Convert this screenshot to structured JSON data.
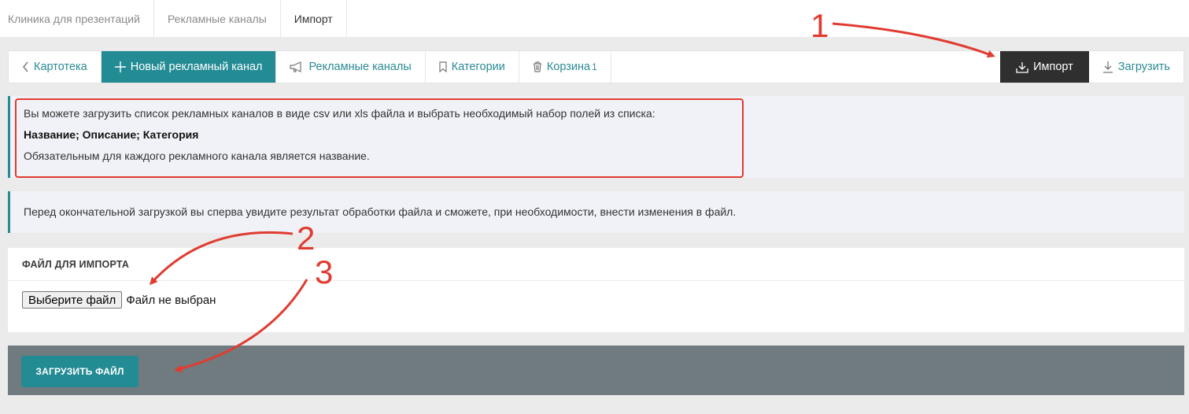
{
  "breadcrumbs": [
    "Клиника для презентаций",
    "Рекламные каналы",
    "Импорт"
  ],
  "toolbar": {
    "back": "Картотека",
    "new_channel": "Новый рекламный канал",
    "channels": "Рекламные каналы",
    "categories": "Категории",
    "trash": "Корзина",
    "trash_count": "1",
    "import": "Импорт",
    "upload": "Загрузить"
  },
  "info": {
    "line1": "Вы можете загрузить список рекламных каналов в виде csv или xls файла и выбрать необходимый набор полей из списка:",
    "line2": "Название; Описание; Категория",
    "line3": "Обязательным для каждого рекламного канала является название.",
    "note": "Перед окончательной загрузкой вы сперва увидите результат обработки файла и сможете, при необходимости, внести изменения в файл."
  },
  "file_card": {
    "title": "ФАЙЛ ДЛЯ ИМПОРТА",
    "choose_button": "Выберите файл",
    "status": "Файл не выбран"
  },
  "submit_label": "ЗАГРУЗИТЬ ФАЙЛ",
  "annotations": [
    "1",
    "2",
    "3"
  ],
  "colors": {
    "accent": "#238b94",
    "annotation": "#e03c31",
    "dark_tab": "#2f2f2f",
    "footer": "#707b7f"
  }
}
